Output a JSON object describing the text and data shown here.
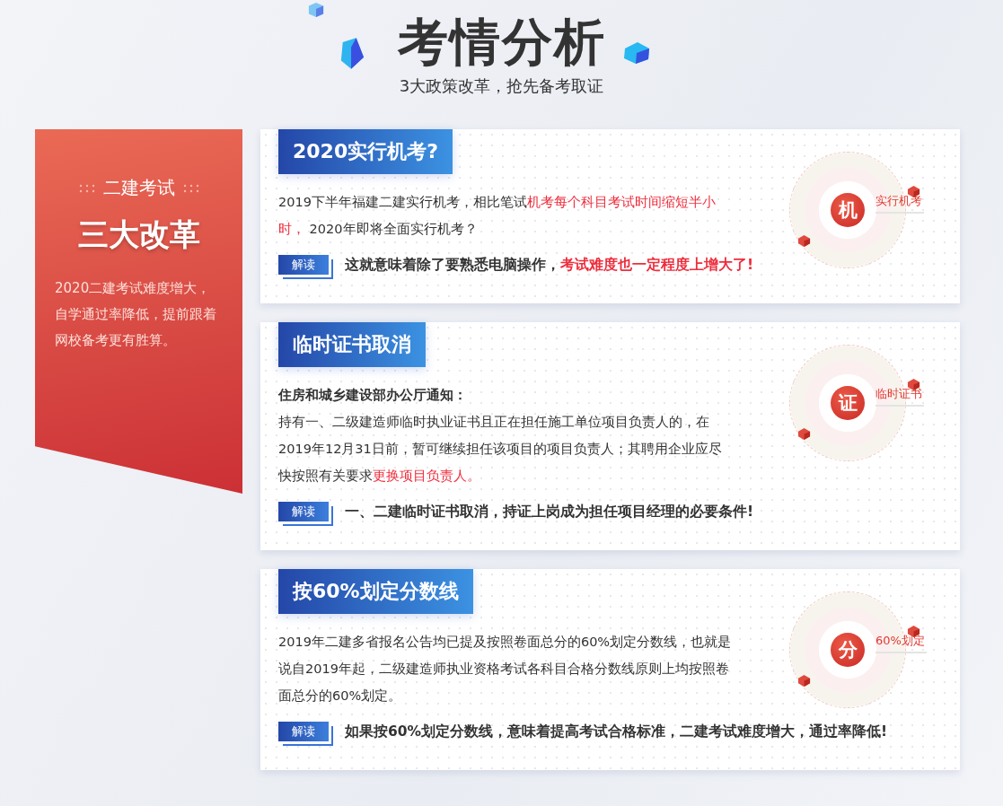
{
  "header": {
    "title": "考情分析",
    "subtitle": "3大政策改革，抢先备考取证"
  },
  "intro": {
    "kicker": "二建考试",
    "headline": "三大改革",
    "text": "2020二建考试难度增大，自学通过率降低，提前跟着网校备考更有胜算。"
  },
  "cards": [
    {
      "title": "2020实行机考?",
      "body": [
        {
          "text": "2019下半年福建二建实行机考，相比笔试",
          "highlight": false
        },
        {
          "text": "机考每个科目考试时间缩短半小时，",
          "highlight": true
        },
        {
          "text": " 2020年即将全面实行机考？",
          "highlight": false
        }
      ],
      "tag": "解读",
      "conclusion": [
        {
          "text": "这就意味着除了要熟悉电脑操作，",
          "highlight": false
        },
        {
          "text": "考试难度也一定程度上增大了!",
          "highlight": true
        }
      ],
      "badge": {
        "char": "机",
        "label": "实行机考"
      }
    },
    {
      "title": "临时证书取消",
      "heading": "住房和城乡建设部办公厅通知：",
      "body": [
        {
          "text": "持有一、二级建造师临时执业证书且正在担任施工单位项目负责人的，在2019年12月31日前，暂可继续担任该项目的项目负责人；其聘用企业应尽快按照有关要求",
          "highlight": false
        },
        {
          "text": "更换项目负责人。",
          "highlight": true
        }
      ],
      "tag": "解读",
      "conclusion": [
        {
          "text": "一、二建临时证书取消，持证上岗成为担任项目经理的必要条件!",
          "highlight": false
        }
      ],
      "badge": {
        "char": "证",
        "label": "临时证书"
      }
    },
    {
      "title": "按60%划定分数线",
      "body": [
        {
          "text": "2019年二建多省报名公告均已提及按照卷面总分的60%划定分数线，也就是说自2019年起，二级建造师执业资格考试各科目合格分数线原则上均按照卷面总分的60%划定。",
          "highlight": false
        }
      ],
      "tag": "解读",
      "conclusion": [
        {
          "text": "如果按60%划定分数线，意味着提高考试合格标准，二建考试难度增大，通过率降低!",
          "highlight": false
        }
      ],
      "badge": {
        "char": "分",
        "label": "60%划定"
      }
    }
  ]
}
